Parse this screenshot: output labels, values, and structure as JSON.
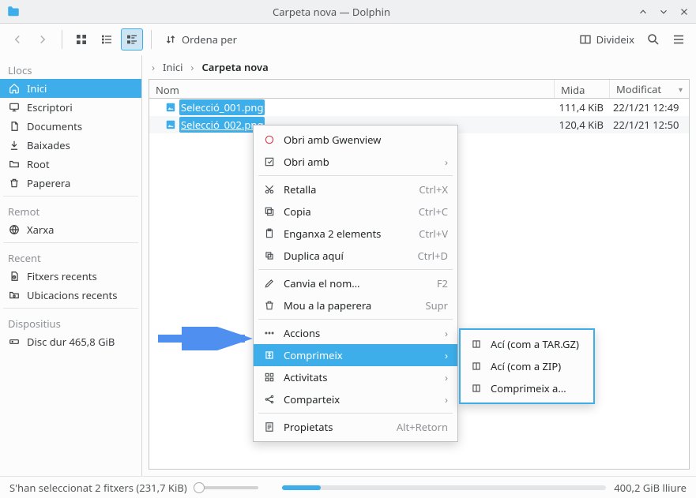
{
  "window": {
    "title": "Carpeta nova — Dolphin"
  },
  "toolbar": {
    "sort_label": "Ordena per",
    "split_label": "Divideix"
  },
  "breadcrumb": {
    "home": "Inici",
    "current": "Carpeta nova"
  },
  "sidebar": {
    "places_label": "Llocs",
    "places": [
      {
        "label": "Inici"
      },
      {
        "label": "Escriptori"
      },
      {
        "label": "Documents"
      },
      {
        "label": "Baixades"
      },
      {
        "label": "Root"
      },
      {
        "label": "Paperera"
      }
    ],
    "remote_label": "Remot",
    "remote": [
      {
        "label": "Xarxa"
      }
    ],
    "recent_label": "Recent",
    "recent": [
      {
        "label": "Fitxers recents"
      },
      {
        "label": "Ubicacions recents"
      }
    ],
    "devices_label": "Dispositius",
    "devices": [
      {
        "label": "Disc dur 465,8 GiB"
      }
    ]
  },
  "columns": {
    "name": "Nom",
    "size": "Mida",
    "modified": "Modificat"
  },
  "files": [
    {
      "name": "Selecció_001.png",
      "size": "111,4 KiB",
      "modified": "22/1/21 12:49"
    },
    {
      "name": "Selecció_002.png",
      "size": "120,4 KiB",
      "modified": "22/1/21 12:50"
    }
  ],
  "context_menu": {
    "open_gwenview": "Obri amb Gwenview",
    "open_with": "Obri amb",
    "cut": "Retalla",
    "cut_sc": "Ctrl+X",
    "copy": "Copia",
    "copy_sc": "Ctrl+C",
    "paste": "Enganxa 2 elements",
    "paste_sc": "Ctrl+V",
    "duplicate": "Duplica aquí",
    "duplicate_sc": "Ctrl+D",
    "rename": "Canvia el nom…",
    "rename_sc": "F2",
    "trash": "Mou a la paperera",
    "trash_sc": "Supr",
    "actions": "Accions",
    "compress": "Comprimeix",
    "activities": "Activitats",
    "share": "Comparteix",
    "properties": "Propietats",
    "properties_sc": "Alt+Retorn"
  },
  "submenu": {
    "tar": "Ací (com a TAR.GZ)",
    "zip": "Ací (com a ZIP)",
    "to": "Comprimeix a…"
  },
  "status": {
    "selection": "S'han seleccionat 2 fitxers (231,7 KiB)",
    "disk_free": "400,2 GiB lliure"
  }
}
